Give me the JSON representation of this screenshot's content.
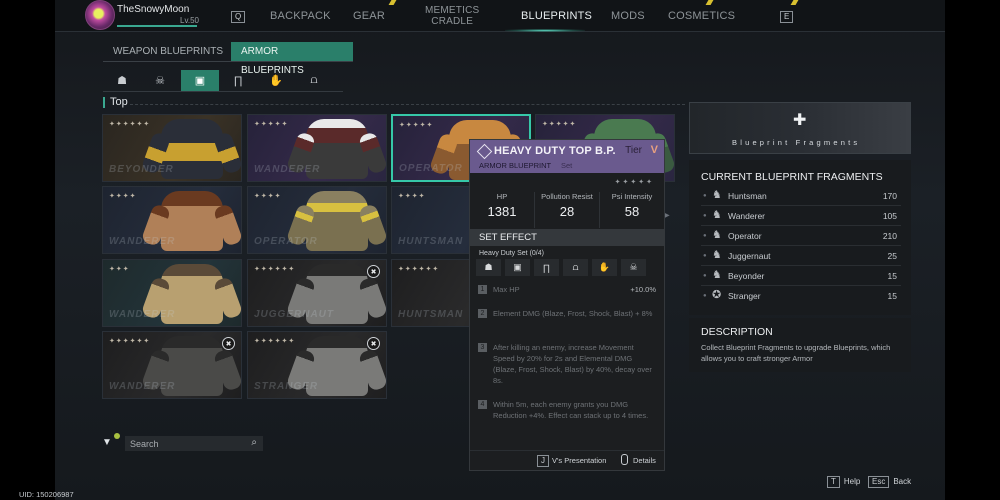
{
  "player": {
    "name": "TheSnowyMoon",
    "level": "Lv.50",
    "uid": "UID: 150206987"
  },
  "nav": {
    "prev_key": "Q",
    "next_key": "E",
    "items": [
      {
        "label": "BACKPACK"
      },
      {
        "label": "GEAR"
      },
      {
        "label": "MEMETICS",
        "label2": "CRADLE"
      },
      {
        "label": "BLUEPRINTS",
        "active": true
      },
      {
        "label": "MODS"
      },
      {
        "label": "COSMETICS"
      }
    ]
  },
  "subtabs": [
    {
      "label": "WEAPON BLUEPRINTS"
    },
    {
      "label": "ARMOR BLUEPRINTS",
      "active": true
    }
  ],
  "categories": [
    {
      "icon": "helmet-icon"
    },
    {
      "icon": "mask-icon"
    },
    {
      "icon": "top-icon",
      "active": true
    },
    {
      "icon": "pants-icon"
    },
    {
      "icon": "gloves-icon"
    },
    {
      "icon": "boots-icon"
    }
  ],
  "section_title": "Top",
  "cards": [
    {
      "brand": "BEYONDER",
      "stars": "✦✦✦✦✦✦",
      "locked": false
    },
    {
      "brand": "WANDERER",
      "stars": "✦✦✦✦✦",
      "locked": false
    },
    {
      "brand": "OPERATOR",
      "stars": "✦✦✦✦✦",
      "locked": false,
      "selected": true
    },
    {
      "brand": "",
      "stars": "✦✦✦✦✦",
      "locked": false
    },
    {
      "brand": "WANDERER",
      "stars": "✦✦✦✦",
      "locked": false
    },
    {
      "brand": "OPERATOR",
      "stars": "✦✦✦✦",
      "locked": false
    },
    {
      "brand": "HUNTSMAN",
      "stars": "✦✦✦✦",
      "locked": false
    },
    {
      "brand": "WANDERER",
      "stars": "✦✦✦",
      "locked": false
    },
    {
      "brand": "JUGGERNAUT",
      "stars": "✦✦✦✦✦✦",
      "locked": true
    },
    {
      "brand": "HUNTSMAN",
      "stars": "✦✦✦✦✦✦",
      "locked": false
    },
    {
      "brand": "WANDERER",
      "stars": "✦✦✦✦✦✦",
      "locked": true
    },
    {
      "brand": "STRANGER",
      "stars": "✦✦✦✦✦✦",
      "locked": true
    }
  ],
  "tooltip": {
    "title": "HEAVY DUTY TOP B.P.",
    "tier_label": "Tier",
    "tier_value": "V",
    "type": "ARMOR BLUEPRINT",
    "set_tag": "Set",
    "stars": "✦✦✦✦✦",
    "stats": [
      {
        "label": "HP",
        "value": "1381"
      },
      {
        "label": "Pollution Resist",
        "value": "28"
      },
      {
        "label": "Psi Intensity",
        "value": "58"
      }
    ],
    "set_effect_title": "SET EFFECT",
    "set_name": "Heavy Duty Set (0/4)",
    "set_pieces": [
      "helmet-icon",
      "top-icon",
      "pants-icon",
      "boots-icon",
      "gloves-icon",
      "mask-icon"
    ],
    "effects": [
      {
        "num": "1",
        "text": "Max HP",
        "value": "+10.0%"
      },
      {
        "num": "2",
        "text": "Element DMG (Blaze, Frost, Shock, Blast) + 8%"
      },
      {
        "num": "3",
        "text": "After killing an enemy, increase Movement Speed by 20% for 2s and Elemental DMG (Blaze, Frost, Shock, Blast) by 40%, decay over 8s."
      },
      {
        "num": "4",
        "text": "Within 5m, each enemy grants you DMG Reduction +4%. Effect can stack up to 4 times."
      }
    ],
    "presentation_key": "J",
    "presentation_label": "V's Presentation",
    "details_label": "Details"
  },
  "fragments": {
    "banner_caption": "Blueprint Fragments",
    "title": "CURRENT BLUEPRINT FRAGMENTS",
    "items": [
      {
        "name": "Huntsman",
        "count": "170"
      },
      {
        "name": "Wanderer",
        "count": "105"
      },
      {
        "name": "Operator",
        "count": "210"
      },
      {
        "name": "Juggernaut",
        "count": "25"
      },
      {
        "name": "Beyonder",
        "count": "15"
      },
      {
        "name": "Stranger",
        "count": "15"
      }
    ]
  },
  "description": {
    "title": "DESCRIPTION",
    "text": "Collect Blueprint Fragments to upgrade Blueprints, which allows you to craft stronger Armor"
  },
  "search": {
    "placeholder": "Search",
    "value": ""
  },
  "footer": {
    "help_key": "T",
    "help_label": "Help",
    "back_key": "Esc",
    "back_label": "Back"
  },
  "colors": {
    "accent": "#2a7f6a",
    "selected_border": "#36c8a8",
    "tooltip_header": "#6a5a8e",
    "tier_color": "#e8a080"
  }
}
